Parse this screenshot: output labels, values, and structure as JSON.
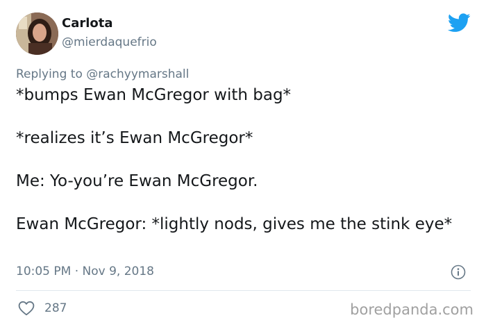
{
  "author": {
    "name": "Carlota",
    "handle": "@mierdaquefrio"
  },
  "reply": {
    "prefix": "Replying to ",
    "handle": "@rachyymarshall"
  },
  "tweet": {
    "lines": [
      "*bumps Ewan McGregor with bag*",
      "*realizes it’s Ewan McGregor*",
      "Me: Yo-you’re Ewan McGregor.",
      "Ewan McGregor: *lightly nods, gives me the stink eye*"
    ]
  },
  "meta": {
    "time": "10:05 PM · Nov 9, 2018"
  },
  "stats": {
    "likes": "287"
  },
  "watermark": "boredpanda.com",
  "colors": {
    "brand_blue": "#1da1f2",
    "secondary_text": "#657786",
    "primary_text": "#14171a",
    "divider": "#e1e8ed"
  },
  "icons": {
    "brand": "bird-logo-icon",
    "info": "info-icon",
    "like": "heart-icon"
  }
}
